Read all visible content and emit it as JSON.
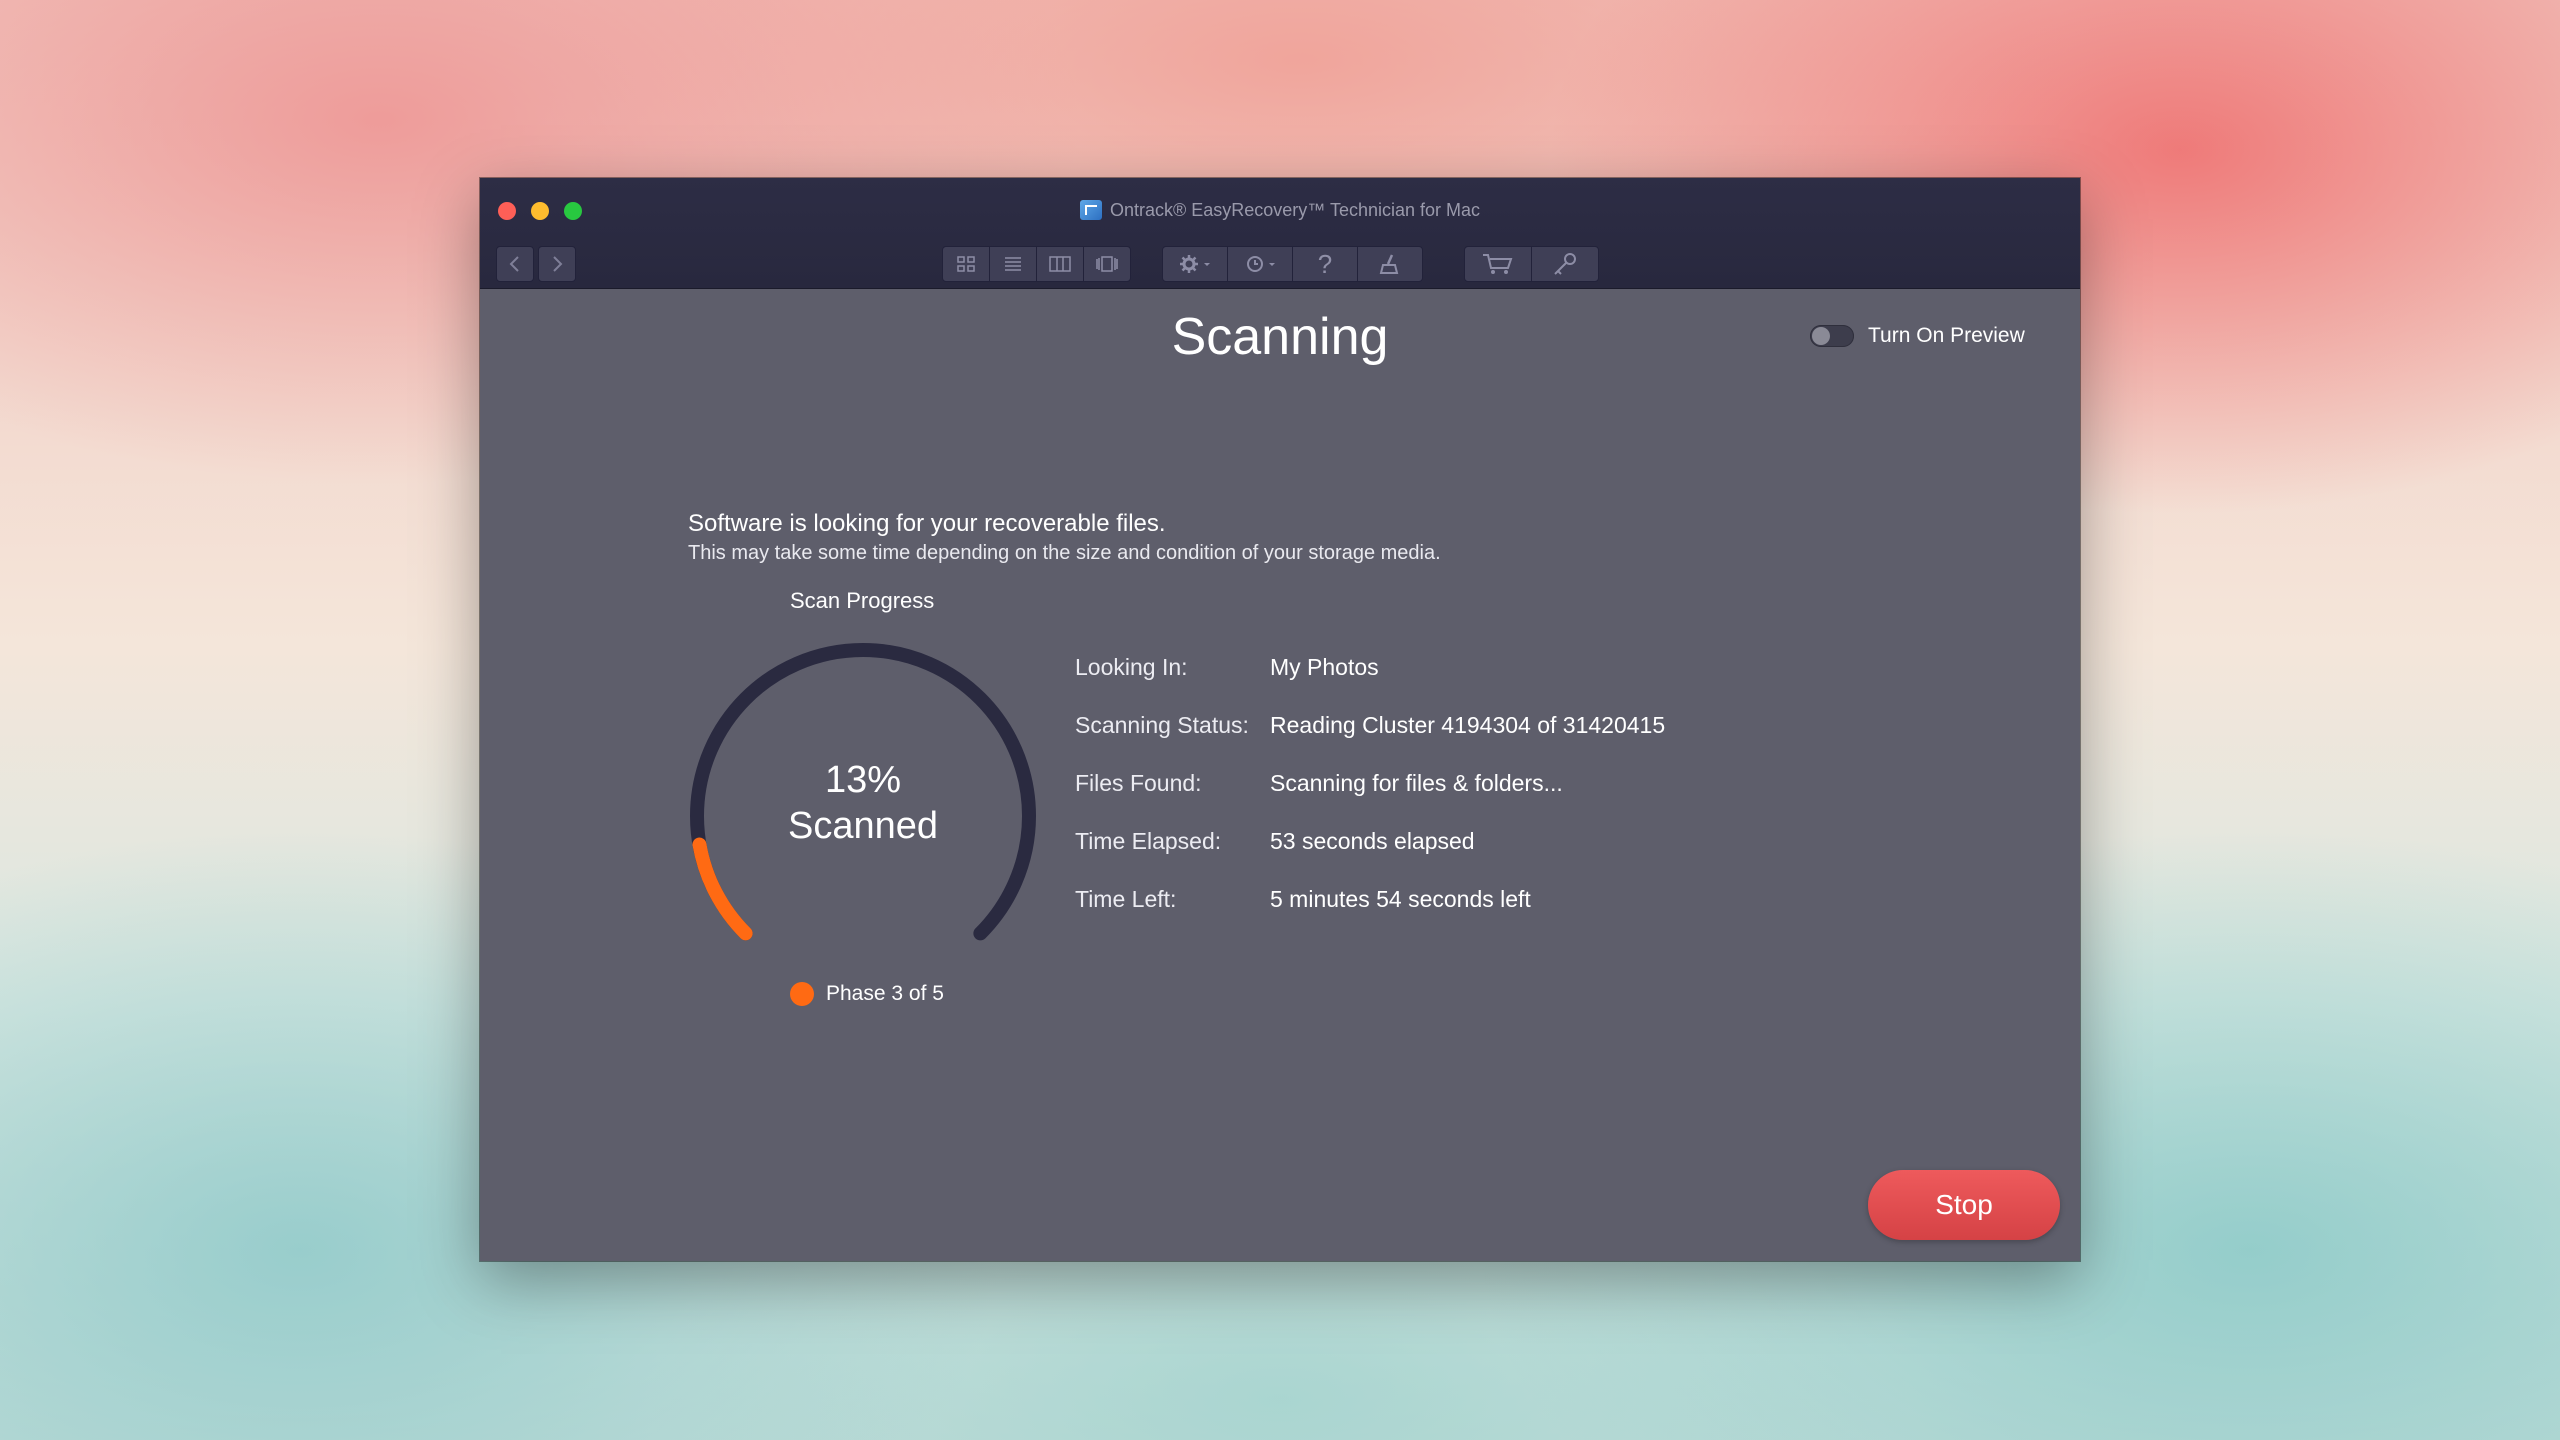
{
  "window": {
    "title": "Ontrack® EasyRecovery™ Technician for Mac"
  },
  "toolbar": {
    "icons": [
      "back-arrow-icon",
      "forward-arrow-icon",
      "grid-view-icon",
      "list-view-icon",
      "column-view-icon",
      "coverflow-view-icon",
      "settings-gear-icon",
      "history-icon",
      "help-icon",
      "clean-brush-icon",
      "cart-icon",
      "key-icon"
    ]
  },
  "main": {
    "heading": "Scanning",
    "preview_toggle_label": "Turn On Preview",
    "preview_on": false,
    "intro_title": "Software is looking for your recoverable files.",
    "intro_subtitle": "This may take some time depending on the size and condition of your storage media.",
    "progress_label": "Scan Progress",
    "progress_percent_text": "13%",
    "progress_word": "Scanned",
    "progress_fraction": 0.13,
    "phase_label": "Phase 3 of 5",
    "details": [
      {
        "key": "Looking In:",
        "value": "My Photos"
      },
      {
        "key": "Scanning Status:",
        "value": "Reading Cluster 4194304 of 31420415"
      },
      {
        "key": "Files Found:",
        "value": "Scanning for files & folders..."
      },
      {
        "key": "Time Elapsed:",
        "value": "53 seconds elapsed"
      },
      {
        "key": "Time Left:",
        "value": "5 minutes 54 seconds left"
      }
    ],
    "stop_label": "Stop"
  },
  "colors": {
    "accent": "#ff6a13",
    "track": "#2a2a40",
    "window_bg": "#5e5e6b",
    "stop_button": "#e24d50"
  }
}
